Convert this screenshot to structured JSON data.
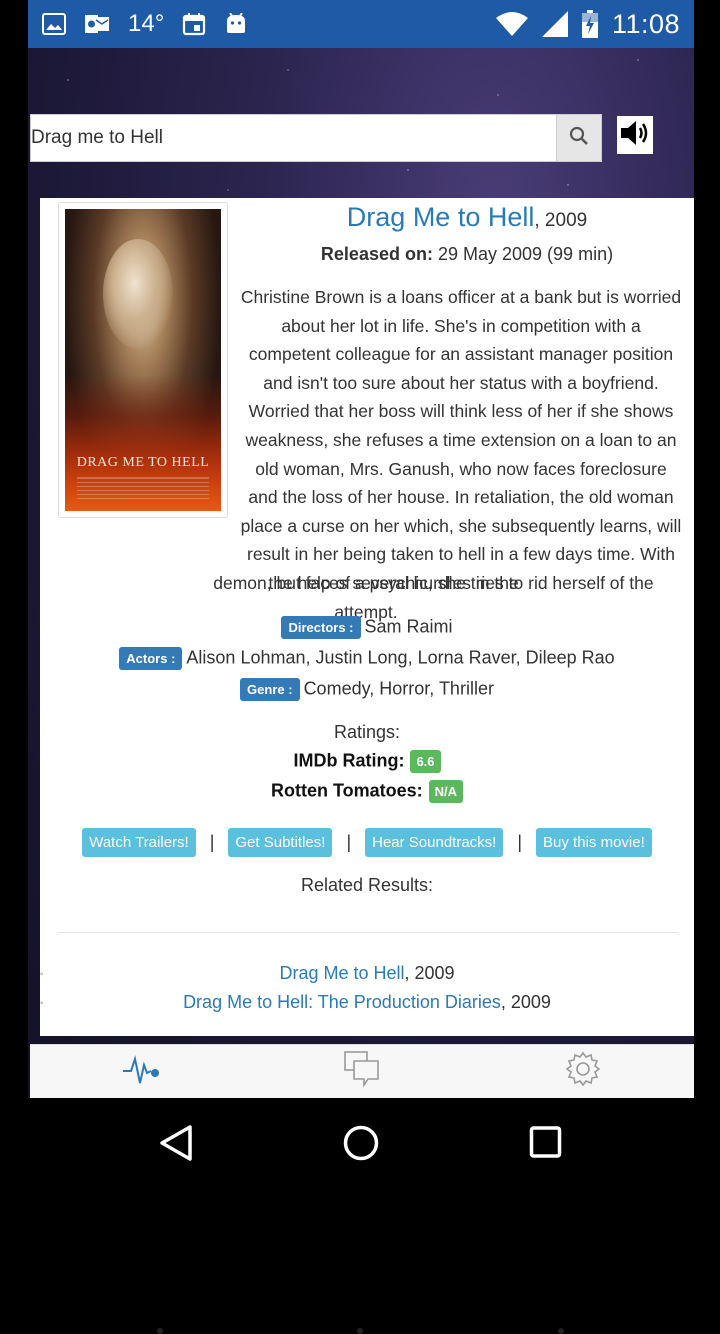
{
  "status_bar": {
    "temperature": "14°",
    "time": "11:08",
    "icons": [
      "image-icon",
      "outlook-icon",
      "calendar-icon",
      "android-icon",
      "wifi-icon",
      "signal-icon",
      "battery-charging-icon"
    ]
  },
  "search": {
    "value": "Drag me to Hell",
    "button_icon": "search-icon",
    "speaker_icon": "speaker-icon"
  },
  "movie": {
    "title": "Drag Me to Hell",
    "year": ", 2009",
    "released_label": "Released on:",
    "released_value": "29 May 2009 (99 min)",
    "plot_part1": "Christine Brown is a loans officer at a bank but is worried about her lot in life. She's in competition with a competent colleague for an assistant manager position and isn't too sure about her status with a boyfriend. Worried that her boss will think less of her if she shows weakness, she refuses a time extension on a loan to an old woman, Mrs. Ganush, who now faces foreclosure and the loss of her house. In retaliation, the old woman place a curse on her which, she subsequently learns, will result in her being taken to hell in a few days time. With the help of a psychic, she tries to rid herself of the",
    "plot_part2": "demon, but faces several hurdles in the attempt.",
    "poster_title": "DRAG ME TO HELL",
    "directors_label": "Directors :",
    "directors": "Sam Raimi",
    "actors_label": "Actors :",
    "actors": "Alison Lohman, Justin Long, Lorna Raver, Dileep Rao",
    "genre_label": "Genre :",
    "genre": "Comedy, Horror, Thriller"
  },
  "ratings": {
    "label": "Ratings:",
    "imdb_label": "IMDb Rating:",
    "imdb_value": "6.6",
    "rt_label": "Rotten Tomatoes:",
    "rt_value": "N/A"
  },
  "actions": {
    "trailers": "Watch Trailers!",
    "subtitles": "Get Subtitles!",
    "soundtracks": "Hear Soundtracks!",
    "buy": "Buy this movie!",
    "separator": "|"
  },
  "related": {
    "label": "Related Results:",
    "items": [
      {
        "title": "Drag Me to Hell",
        "year": ", 2009"
      },
      {
        "title": "Drag Me to Hell: The Production Diaries",
        "year": ", 2009"
      }
    ]
  },
  "tabbar": {
    "tabs": [
      "pulse-icon",
      "chat-icon",
      "settings-icon"
    ],
    "active_color": "#2a7ab8"
  },
  "colors": {
    "status_bar": "#1f5aa6",
    "link": "#2a7ab8",
    "badge_primary": "#337ab7",
    "badge_success": "#5cb85c",
    "badge_info": "#5bc0de"
  }
}
